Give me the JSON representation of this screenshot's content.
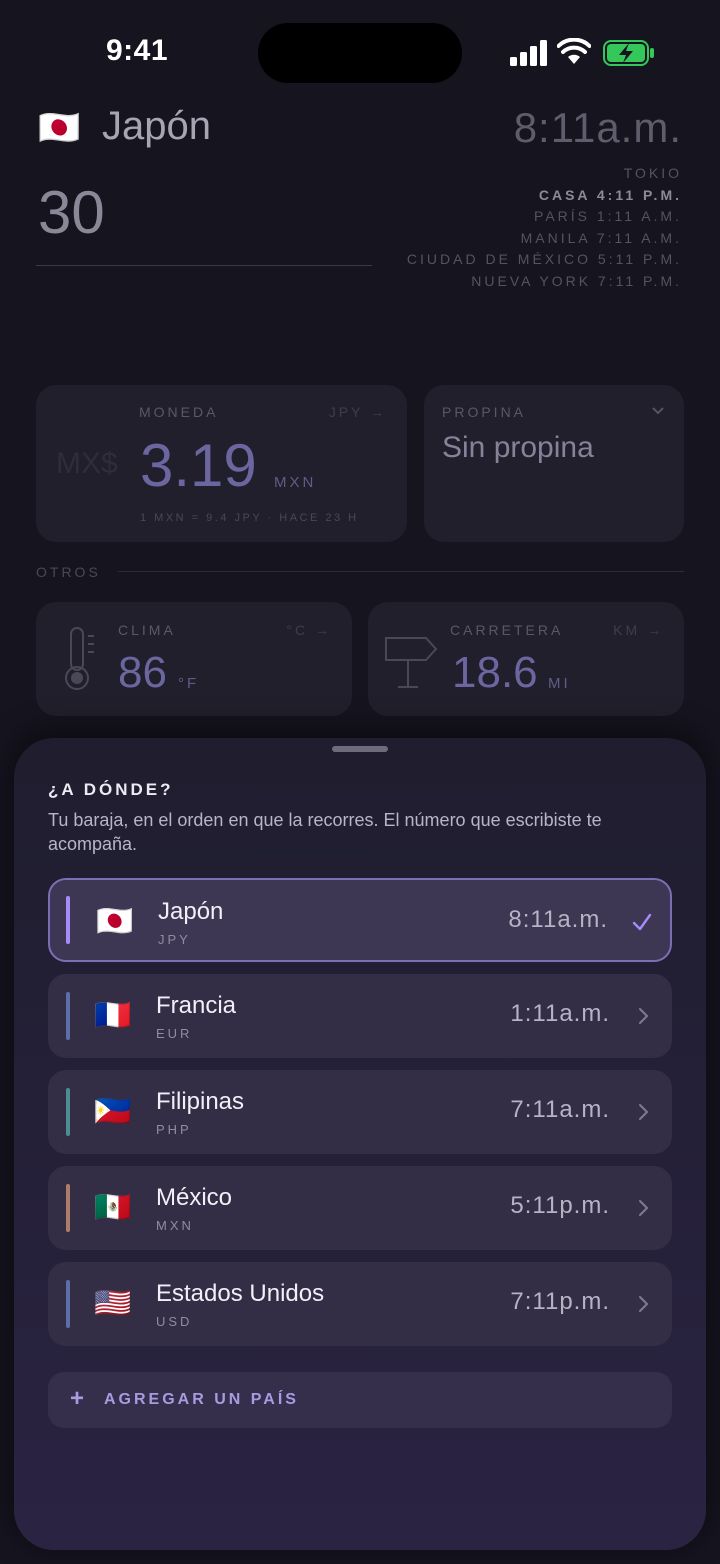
{
  "status_bar": {
    "time": "9:41"
  },
  "header": {
    "country_flag": "🇯🇵",
    "country_name": "Japón",
    "amount": "30",
    "local_time": "8:11a.m.",
    "cities": [
      {
        "label": "TOKIO",
        "home": false
      },
      {
        "label": "CASA 4:11 P.M.",
        "home": true
      },
      {
        "label": "PARÍS  1:11 A.M.",
        "home": false
      },
      {
        "label": "MANILA  7:11 A.M.",
        "home": false
      },
      {
        "label": "CIUDAD DE MÉXICO  5:11 P.M.",
        "home": false
      },
      {
        "label": "NUEVA YORK  7:11 P.M.",
        "home": false
      }
    ]
  },
  "currency_card": {
    "label": "MONEDA",
    "code": "JPY →",
    "symbol": "MX$",
    "value": "3.19",
    "unit": "MXN",
    "rate": "1 MXN = 9.4 JPY  ·  HACE 23 H"
  },
  "tip_card": {
    "label": "PROPINA",
    "value": "Sin propina"
  },
  "section_otros": "OTROS",
  "weather_card": {
    "label": "CLIMA",
    "switch": "°C →",
    "value": "86",
    "unit": "°F"
  },
  "road_card": {
    "label": "CARRETERA",
    "switch": "KM →",
    "value": "18.6",
    "unit": "MI"
  },
  "sheet": {
    "title": "¿A DÓNDE?",
    "description": "Tu baraja, en el orden en que la recorres. El número que escribiste te acompaña.",
    "countries": [
      {
        "flag": "🇯🇵",
        "name": "Japón",
        "code": "JPY",
        "time": "8:11a.m.",
        "accent": "#a78bfa",
        "selected": true
      },
      {
        "flag": "🇫🇷",
        "name": "Francia",
        "code": "EUR",
        "time": "1:11a.m.",
        "accent": "#5b6fa8",
        "selected": false
      },
      {
        "flag": "🇵🇭",
        "name": "Filipinas",
        "code": "PHP",
        "time": "7:11a.m.",
        "accent": "#4f8c92",
        "selected": false
      },
      {
        "flag": "🇲🇽",
        "name": "México",
        "code": "MXN",
        "time": "5:11p.m.",
        "accent": "#b07c6a",
        "selected": false
      },
      {
        "flag": "🇺🇸",
        "name": "Estados Unidos",
        "code": "USD",
        "time": "7:11p.m.",
        "accent": "#5b6fa8",
        "selected": false
      }
    ],
    "add_label": "AGREGAR UN PAÍS"
  }
}
